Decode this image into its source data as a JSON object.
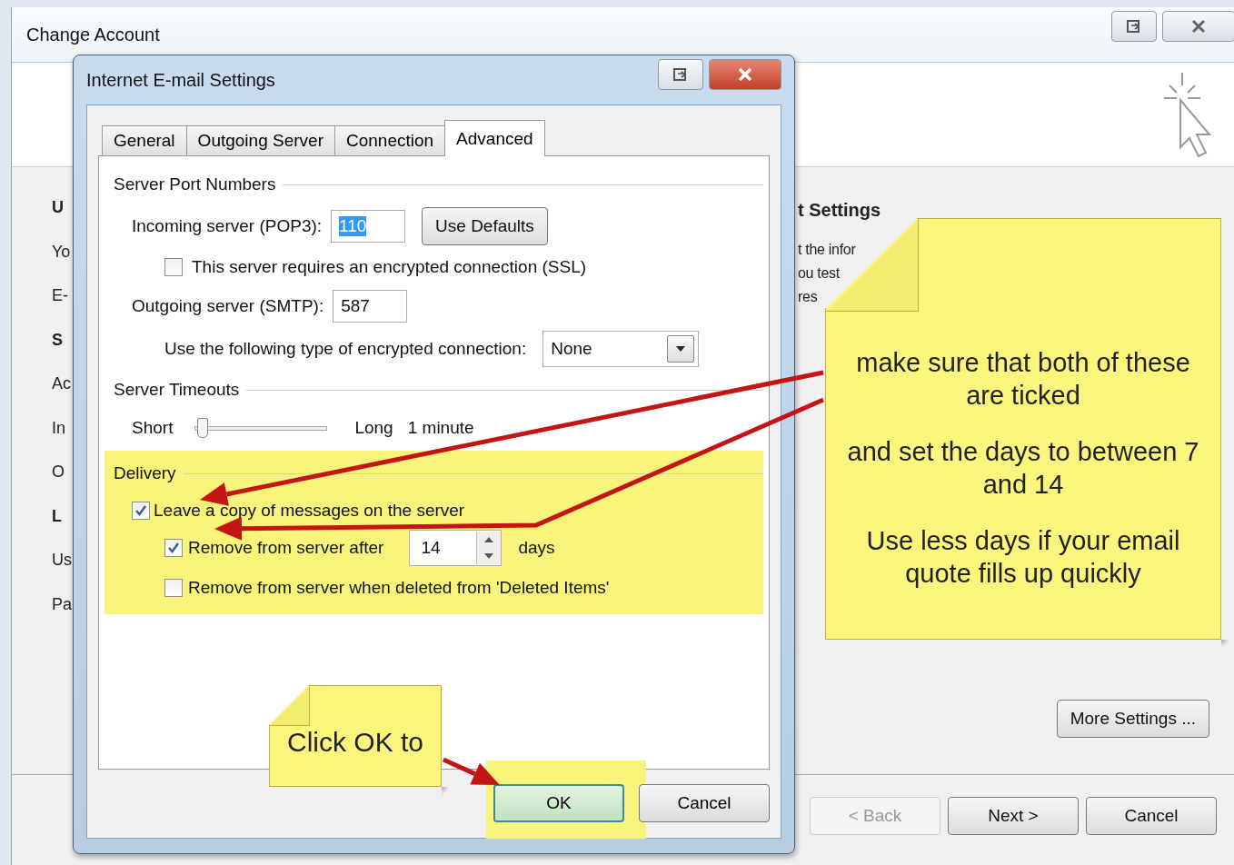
{
  "background_window": {
    "title": "Change Account",
    "left_fragments": [
      {
        "text": "U",
        "bold": true
      },
      {
        "text": "Yo",
        "bold": false
      },
      {
        "text": "E-",
        "bold": false
      },
      {
        "text": "S",
        "bold": true
      },
      {
        "text": "Ac",
        "bold": false
      },
      {
        "text": "In",
        "bold": false
      },
      {
        "text": "O",
        "bold": false
      },
      {
        "text": "L",
        "bold": true
      },
      {
        "text": "Us",
        "bold": false
      },
      {
        "text": "Pa",
        "bold": false
      }
    ],
    "right_fragments": [
      {
        "text": "t Settings",
        "bold": true
      },
      {
        "text": "t the infor",
        "bold": false
      },
      {
        "text": "ou test",
        "bold": false
      },
      {
        "text": "res",
        "bold": false
      }
    ],
    "more_settings_button": "More Settings ...",
    "footer_buttons": [
      {
        "label": "< Back",
        "disabled": true
      },
      {
        "label": "Next >",
        "disabled": false
      },
      {
        "label": "Cancel",
        "disabled": false
      }
    ]
  },
  "dialog": {
    "title": "Internet E-mail Settings",
    "tabs": [
      {
        "label": "General",
        "selected": false
      },
      {
        "label": "Outgoing Server",
        "selected": false
      },
      {
        "label": "Connection",
        "selected": false
      },
      {
        "label": "Advanced",
        "selected": true
      }
    ],
    "server_ports": {
      "heading": "Server Port Numbers",
      "incoming_label": "Incoming server (POP3):",
      "incoming_value": "110",
      "use_defaults": "Use Defaults",
      "ssl": {
        "label": "This server requires an encrypted connection (SSL)",
        "checked": false
      },
      "outgoing_label": "Outgoing server (SMTP):",
      "outgoing_value": "587",
      "encryption_label": "Use the following type of encrypted connection:",
      "encryption_value": "None"
    },
    "timeouts": {
      "heading": "Server Timeouts",
      "short": "Short",
      "long": "Long",
      "level": 0.05,
      "reading": "1 minute"
    },
    "delivery": {
      "heading": "Delivery",
      "highlighted": true,
      "leave_copy": {
        "label": "Leave a copy of messages on the server",
        "checked": true
      },
      "remove_after": {
        "label": "Remove from server after",
        "checked": true,
        "days": "14",
        "unit": "days"
      },
      "remove_deleted": {
        "label": "Remove from server when deleted from 'Deleted Items'",
        "checked": false
      }
    },
    "buttons": [
      {
        "label": "OK",
        "highlighted": true
      },
      {
        "label": "Cancel",
        "highlighted": false
      }
    ]
  },
  "notes": [
    {
      "kind": "large",
      "paragraphs": [
        "make sure that both of these are ticked",
        "and set the days to between 7 and 14",
        "Use less days if your email quote fills up quickly"
      ]
    },
    {
      "kind": "small",
      "paragraphs": [
        "Click OK to"
      ]
    }
  ]
}
